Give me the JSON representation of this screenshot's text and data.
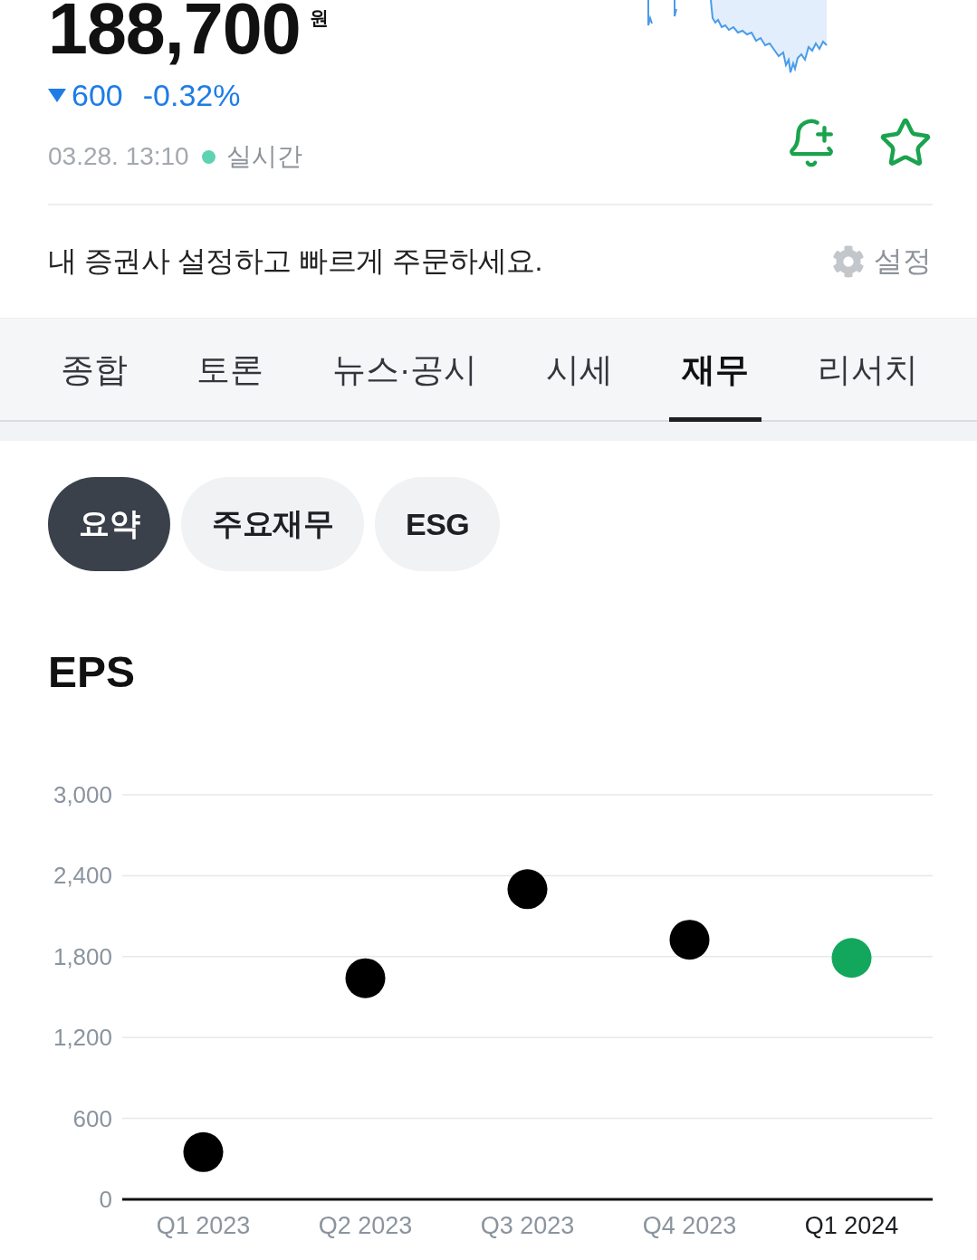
{
  "stock": {
    "price": "188,700",
    "currency": "원",
    "change": {
      "falling": true,
      "amount": "600",
      "percent": "-0.32%"
    },
    "timestamp": "03.28. 13:10",
    "live_label": "실시간",
    "favorite": false
  },
  "banner": {
    "text": "내 증권사 설정하고 빠르게 주문하세요.",
    "settings_label": "설정"
  },
  "tabs": [
    {
      "label": "종합",
      "selected": false
    },
    {
      "label": "토론",
      "selected": false
    },
    {
      "label": "뉴스·공시",
      "selected": false
    },
    {
      "label": "시세",
      "selected": false
    },
    {
      "label": "재무",
      "selected": true
    },
    {
      "label": "리서치",
      "selected": false
    }
  ],
  "subtabs": [
    {
      "label": "요약",
      "selected": true
    },
    {
      "label": "주요재무",
      "selected": false
    },
    {
      "label": "ESG",
      "selected": false
    }
  ],
  "section": {
    "title": "EPS",
    "chart_data": {
      "type": "scatter",
      "grid": true,
      "categories": [
        "Q1 2023",
        "Q2 2023",
        "Q3 2023",
        "Q4 2023",
        "Q1 2024"
      ],
      "series": [
        {
          "color": "#000000",
          "values": [
            350,
            1640,
            2300,
            1925,
            null
          ]
        },
        {
          "color": "#13a75e",
          "values": [
            null,
            null,
            null,
            null,
            1790
          ]
        }
      ],
      "ylim": [
        0,
        3000
      ],
      "yticks": [
        {
          "value": 0,
          "label": "0"
        },
        {
          "value": 600,
          "label": "600"
        },
        {
          "value": 1200,
          "label": "1,200"
        },
        {
          "value": 1800,
          "label": "1,800"
        },
        {
          "value": 2400,
          "label": "2,400"
        },
        {
          "value": 3000,
          "label": "3,000"
        }
      ]
    }
  }
}
